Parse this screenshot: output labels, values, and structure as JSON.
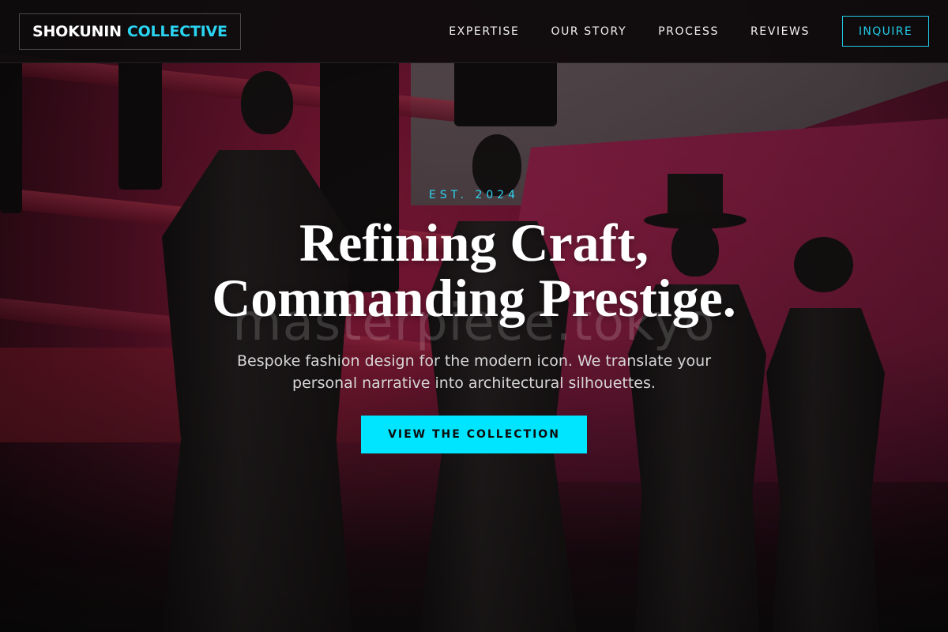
{
  "brand": {
    "word1": "SHOKUNIN",
    "word2": "COLLECTIVE"
  },
  "nav": {
    "links": [
      "EXPERTISE",
      "OUR STORY",
      "PROCESS",
      "REVIEWS"
    ],
    "inquire_label": "INQUIRE"
  },
  "hero": {
    "eyebrow": "EST. 2024",
    "headline_line1": "Refining Craft,",
    "headline_line2": "Commanding Prestige.",
    "watermark": "masterpiece.tokyo",
    "subtitle": "Bespoke fashion design for the modern icon. We translate your personal narrative into architectural silhouettes.",
    "cta_label": "VIEW THE COLLECTION"
  },
  "colors": {
    "accent": "#00e5ff",
    "accent_text": "#2ad4f0",
    "nav_bg": "#0c0c0c",
    "backdrop": "#a01e45"
  }
}
